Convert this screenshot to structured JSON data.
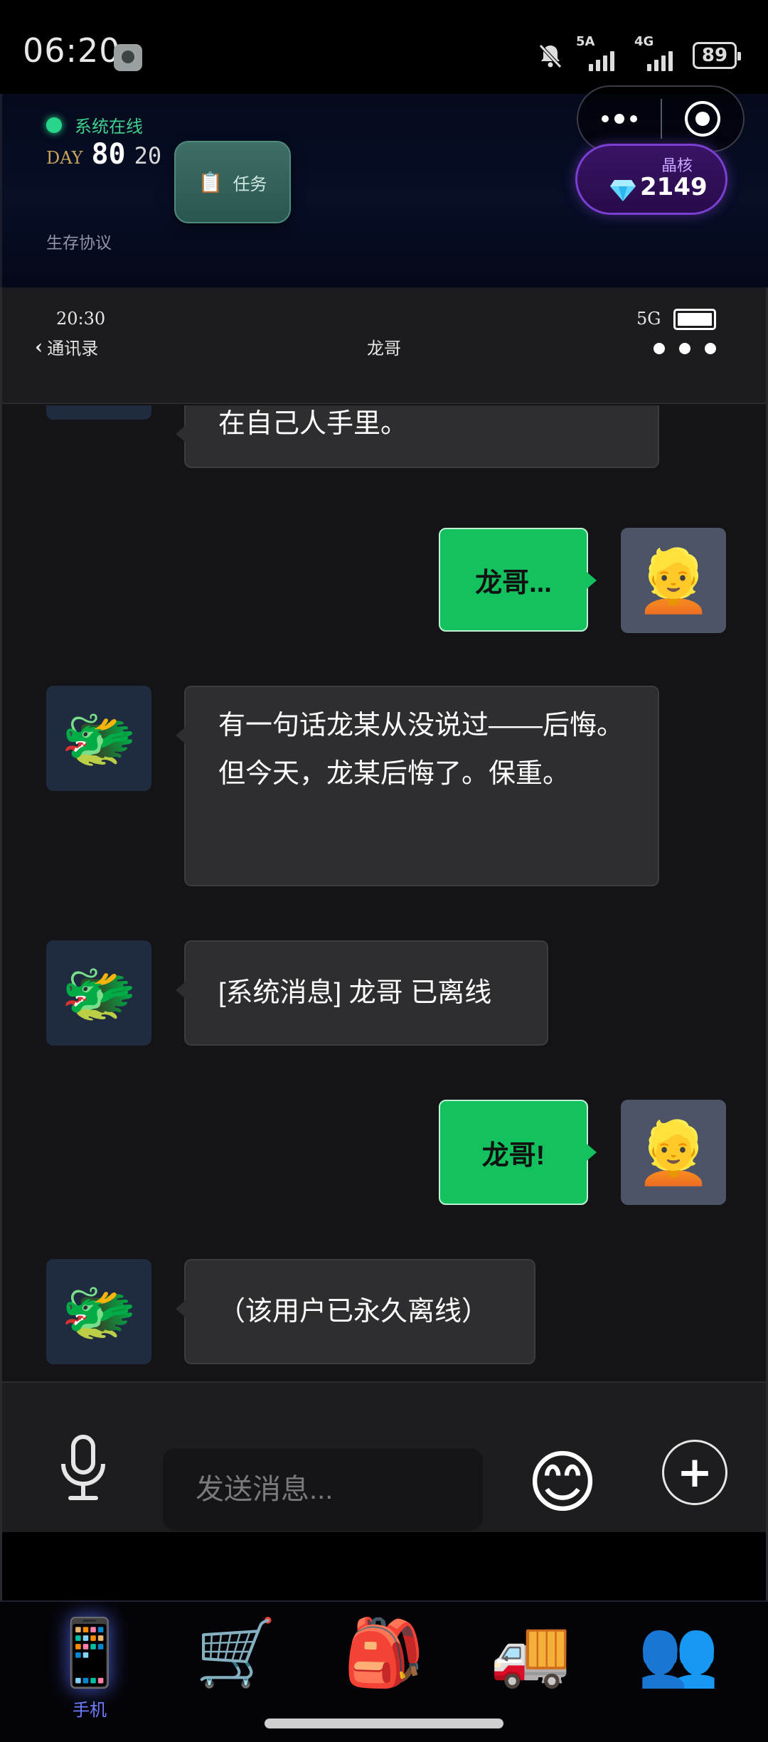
{
  "status_bar": {
    "time": "06:20",
    "network_5g": "5A",
    "network_4g": "4G",
    "battery": "89"
  },
  "game_header": {
    "online_text": "系统在线",
    "day_label": "DAY",
    "day_number": "80",
    "day_sub": "20",
    "task_button": "任务",
    "protocol_text": "生存协议",
    "crystal_label": "晶核",
    "crystal_value": "2149"
  },
  "phone": {
    "time": "20:30",
    "network": "5G",
    "back_label": "通讯录",
    "chat_title": "龙哥"
  },
  "messages": [
    {
      "from": "dragon",
      "text": "在自己人手里。"
    },
    {
      "from": "me",
      "text": "龙哥..."
    },
    {
      "from": "dragon",
      "text": "有一句话龙某从没说过——后悔。但今天，龙某后悔了。保重。"
    },
    {
      "from": "dragon",
      "text": "[系统消息] 龙哥 已离线"
    },
    {
      "from": "me",
      "text": "龙哥!"
    },
    {
      "from": "dragon",
      "text": "（该用户已永久离线）"
    }
  ],
  "avatars": {
    "dragon": "🐲",
    "me": "👱"
  },
  "input": {
    "placeholder": "发送消息...",
    "emoji": "😊",
    "plus": "+"
  },
  "bottom_nav": [
    {
      "icon": "📱",
      "label": "手机",
      "active": true
    },
    {
      "icon": "🛒",
      "label": "",
      "active": false
    },
    {
      "icon": "🎒",
      "label": "",
      "active": false
    },
    {
      "icon": "🚚",
      "label": "",
      "active": false
    },
    {
      "icon": "👥",
      "label": "",
      "active": false
    }
  ],
  "colors": {
    "accent_green": "#13c25e",
    "online_green": "#27d68a",
    "crystal_purple": "#7b3fd1",
    "nav_active": "#6f7cff"
  }
}
